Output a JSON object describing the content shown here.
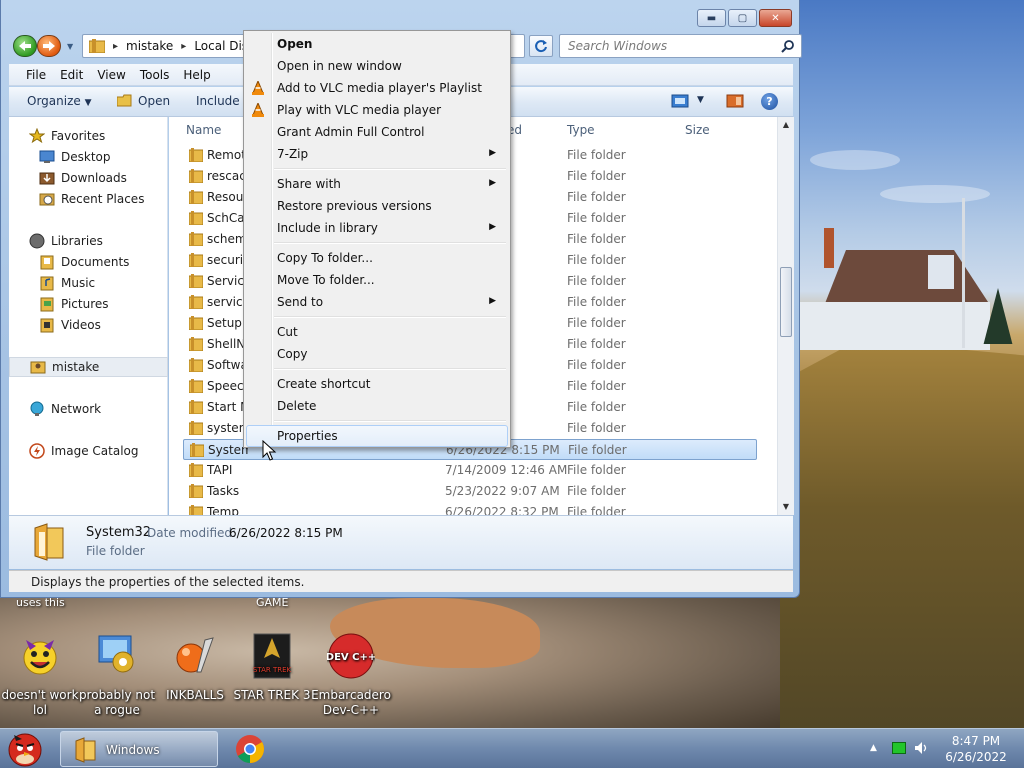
{
  "window": {
    "title_buttons": {
      "minimize": "▬",
      "maximize": "▢",
      "close": "✕"
    }
  },
  "address_bar": {
    "crumbs": [
      "mistake",
      "Local Disk ("
    ],
    "search_placeholder": "Search Windows"
  },
  "menubar": {
    "items": [
      "File",
      "Edit",
      "View",
      "Tools",
      "Help"
    ]
  },
  "command_bar": {
    "organize": "Organize",
    "open": "Open",
    "include": "Include in library"
  },
  "nav_pane": {
    "items": [
      {
        "label": "Favorites",
        "icon": "star-icon"
      },
      {
        "label": "Desktop",
        "icon": "desktop-icon"
      },
      {
        "label": "Downloads",
        "icon": "downloads-icon"
      },
      {
        "label": "Recent Places",
        "icon": "recent-places-icon"
      },
      {
        "label": "Libraries",
        "icon": "libraries-icon"
      },
      {
        "label": "Documents",
        "icon": "documents-icon"
      },
      {
        "label": "Music",
        "icon": "music-icon"
      },
      {
        "label": "Pictures",
        "icon": "pictures-icon"
      },
      {
        "label": "Videos",
        "icon": "videos-icon"
      },
      {
        "label": "mistake",
        "icon": "user-folder-icon"
      },
      {
        "label": "Network",
        "icon": "network-icon"
      },
      {
        "label": "Image Catalog",
        "icon": "image-catalog-icon"
      }
    ]
  },
  "file_list": {
    "columns": {
      "name": "Name",
      "date": "ed",
      "type": "Type",
      "size": "Size"
    },
    "rows": [
      {
        "name": "Remot",
        "date": ":46 PM",
        "type": "File folder"
      },
      {
        "name": "rescach",
        "date": ":03 AM",
        "type": "File folder"
      },
      {
        "name": "Resour",
        "date": " AM",
        "type": "File folder"
      },
      {
        "name": "SchCac",
        "date": ":05 PM",
        "type": "File folder"
      },
      {
        "name": "schem",
        "date": ":52 AM",
        "type": "File folder"
      },
      {
        "name": "securit",
        "date": ":46 PM",
        "type": "File folder"
      },
      {
        "name": "Service",
        "date": ":34 AM",
        "type": "File folder"
      },
      {
        "name": "servicin",
        "date": ":38 PM",
        "type": "File folder"
      },
      {
        "name": "Setup",
        "date": ":14 AM",
        "type": "File folder"
      },
      {
        "name": "ShellN",
        "date": ":46 PM",
        "type": "File folder"
      },
      {
        "name": "Softwa",
        "date": ":12 AM",
        "type": "File folder"
      },
      {
        "name": "Speech",
        "date": ":38 PM",
        "type": "File folder"
      },
      {
        "name": "Start M",
        "date": ":05 AM",
        "type": "File folder"
      },
      {
        "name": "system",
        "date": ":49 PM",
        "type": "File folder"
      },
      {
        "name": "System3",
        "date": "6/26/2022 8:15 PM",
        "type": "File folder",
        "selected": true
      },
      {
        "name": "TAPI",
        "date": "7/14/2009 12:46 AM",
        "type": "File folder"
      },
      {
        "name": "Tasks",
        "date": "5/23/2022 9:07 AM",
        "type": "File folder"
      },
      {
        "name": "Temp",
        "date": "6/26/2022 8:32 PM",
        "type": "File folder"
      }
    ]
  },
  "details_pane": {
    "name": "System32",
    "date_label": "Date modified:",
    "date_value": "6/26/2022 8:15 PM",
    "type": "File folder"
  },
  "status_bar": {
    "text": "Displays the properties of the selected items."
  },
  "context_menu": {
    "items": [
      {
        "label": "Open",
        "bold": true
      },
      {
        "label": "Open in new window"
      },
      {
        "label": "Add to VLC media player's Playlist",
        "icon": "vlc-cone-icon"
      },
      {
        "label": "Play with VLC media player",
        "icon": "vlc-cone-icon"
      },
      {
        "label": "Grant Admin Full Control"
      },
      {
        "label": "7-Zip",
        "submenu": true
      },
      {
        "separator": true
      },
      {
        "label": "Share with",
        "submenu": true
      },
      {
        "label": "Restore previous versions"
      },
      {
        "label": "Include in library",
        "submenu": true
      },
      {
        "separator": true
      },
      {
        "label": "Copy To folder..."
      },
      {
        "label": "Move To folder..."
      },
      {
        "label": "Send to",
        "submenu": true
      },
      {
        "separator": true
      },
      {
        "label": "Cut"
      },
      {
        "label": "Copy"
      },
      {
        "separator": true
      },
      {
        "label": "Create shortcut"
      },
      {
        "label": "Delete"
      },
      {
        "separator": true
      },
      {
        "label": "Properties",
        "hover": true
      }
    ],
    "submenu_arrow": "▶"
  },
  "desktop_icons": [
    {
      "label": "doesn't work lol",
      "icon": "yahoo-messenger-icon"
    },
    {
      "label": "probably not a rogue",
      "icon": "gear-monitor-icon"
    },
    {
      "label": "INKBALLS",
      "icon": "inkballs-icon"
    },
    {
      "label": "STAR TREK 3",
      "icon": "star-trek-icon"
    },
    {
      "label": "Embarcadero Dev-C++",
      "icon": "devcpp-icon"
    }
  ],
  "desktop_truncated_labels": [
    "uses this",
    "GAME"
  ],
  "devcpp_glyph_text": "DEV C++",
  "startrek_glyph_text": "STAR TREK",
  "taskbar": {
    "window_label": "Windows",
    "clock_time": "8:47 PM",
    "clock_date": "6/26/2022",
    "tray_arrow": "▲"
  },
  "colors": {
    "selection": "#cce4fa",
    "menu_hover_border": "#aecff7",
    "folder_yellow": "#e8b948"
  }
}
